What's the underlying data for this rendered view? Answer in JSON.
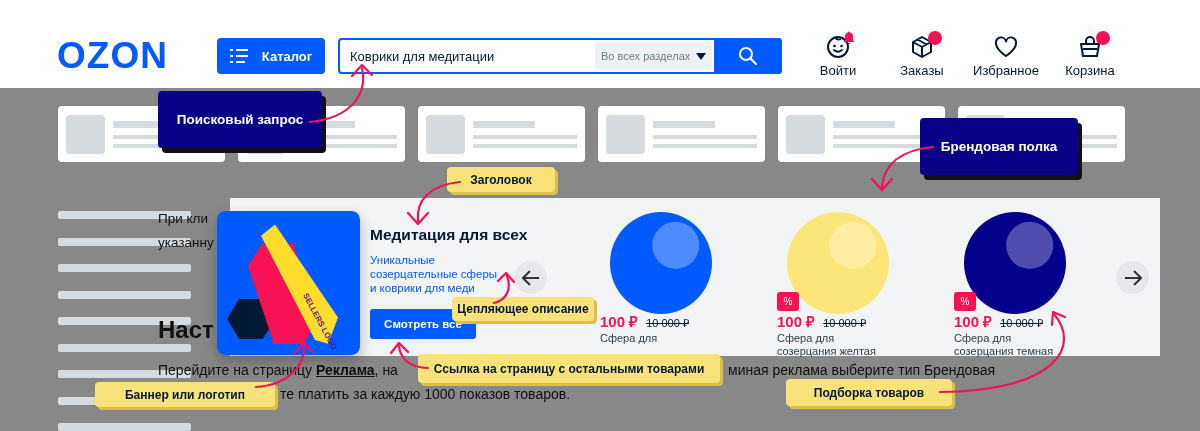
{
  "header": {
    "logo": "OZON",
    "catalog_button": "Каталог",
    "search": {
      "value": "Коврики для медитации",
      "scope": "Во всех разделах"
    },
    "nav": [
      {
        "label": "Войти",
        "notification": true
      },
      {
        "label": "Заказы",
        "notification": true
      },
      {
        "label": "Избранное",
        "notification": false
      },
      {
        "label": "Корзина",
        "notification": true
      }
    ]
  },
  "article": {
    "lines": [
      "При кли",
      "указанну"
    ],
    "heading": "Наст",
    "paragraph": {
      "before": "Перейдите на страницу ",
      "link": "Реклама",
      "after": ", на",
      "tail": "миная реклама выберите тип Брендовая",
      "last": "те платить за каждую 1000 показов товаров."
    }
  },
  "brand_shelf": {
    "logo_text": "SELLERS LOGO",
    "title": "Медитация для всех",
    "description": "Уникальные созерцательные сферы и коврики для меди",
    "button": "Смотреть все",
    "products": [
      {
        "price": "100 ₽",
        "old_price": "10 000 ₽",
        "name": "Сфера для",
        "color": "#005bff"
      },
      {
        "price": "100 ₽",
        "old_price": "10 000 ₽",
        "name": "Сфера для созерцания желтая",
        "color": "#fbe67a",
        "badge": "%"
      },
      {
        "price": "100 ₽",
        "old_price": "10 000 ₽",
        "name": "Сфера для созерцания темная",
        "color": "#05008c",
        "badge": "%"
      }
    ]
  },
  "callouts": [
    {
      "text": "Поисковый запрос",
      "kind": "dark"
    },
    {
      "text": "Брендовая полка",
      "kind": "dark"
    },
    {
      "text": "Заголовок",
      "kind": "yellow"
    },
    {
      "text": "Цепляющее описание",
      "kind": "yellow"
    },
    {
      "text": "Ссылка на страницу с остальными товарами",
      "kind": "yellow"
    },
    {
      "text": "Баннер или логотип",
      "kind": "yellow"
    },
    {
      "text": "Подборка товаров",
      "kind": "yellow"
    }
  ]
}
